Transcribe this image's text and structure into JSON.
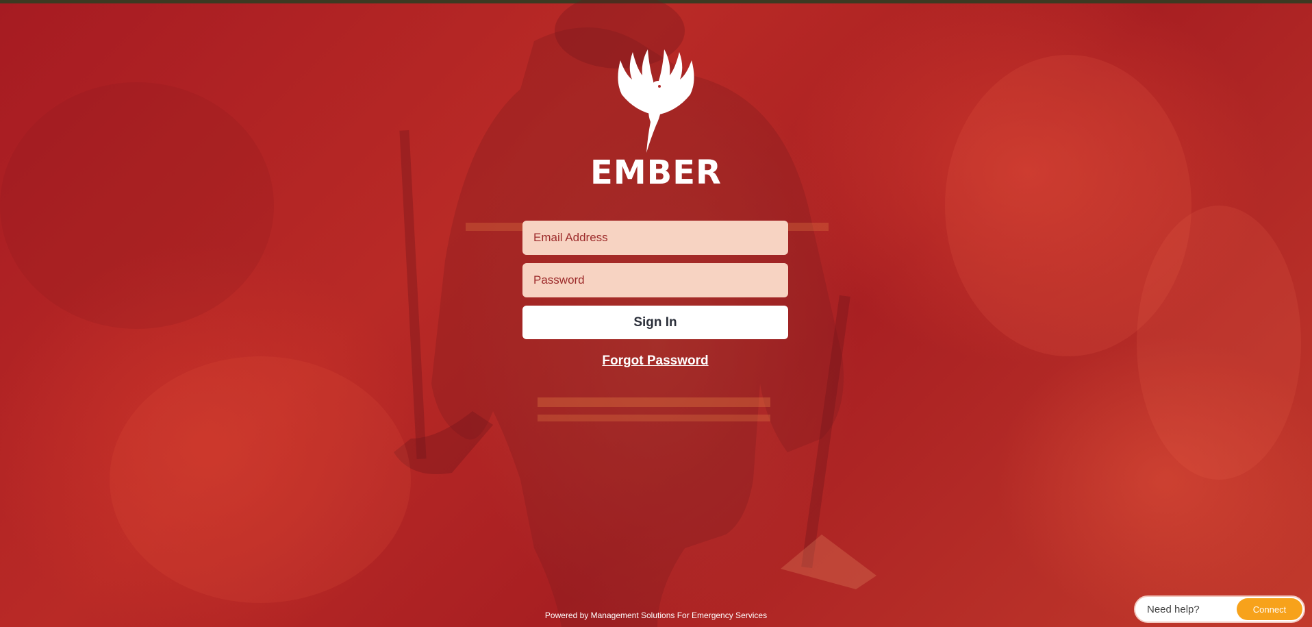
{
  "brand": {
    "name": "EMBER",
    "logo_icon": "phoenix-icon"
  },
  "login": {
    "email_placeholder": "Email Address",
    "password_placeholder": "Password",
    "signin_label": "Sign In",
    "forgot_label": "Forgot Password"
  },
  "footer": {
    "text": "Powered by Management Solutions For Emergency Services"
  },
  "help_widget": {
    "prompt": "Need help?",
    "connect_label": "Connect"
  },
  "colors": {
    "background": "#b02526",
    "field_background": "#f7d3c2",
    "connect_button": "#f7a21b"
  }
}
